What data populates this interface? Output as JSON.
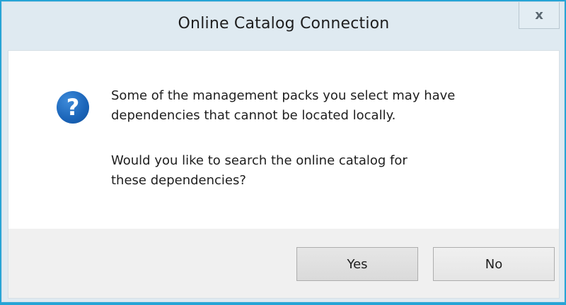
{
  "dialog": {
    "title": "Online Catalog Connection",
    "close_label": "x",
    "icon": "question-icon",
    "icon_glyph": "?",
    "message_line1": "Some of the management packs you select may have",
    "message_line2": "dependencies that cannot be located locally.",
    "question_line1": "Would you like to search the online catalog for",
    "question_line2": "these dependencies?",
    "buttons": {
      "yes": "Yes",
      "no": "No"
    }
  },
  "colors": {
    "window_border": "#26a4d6",
    "frame_background": "#dfeaf1",
    "content_background": "#ffffff",
    "button_bar_background": "#f0f0f0",
    "icon_blue": "#1a64b8"
  }
}
